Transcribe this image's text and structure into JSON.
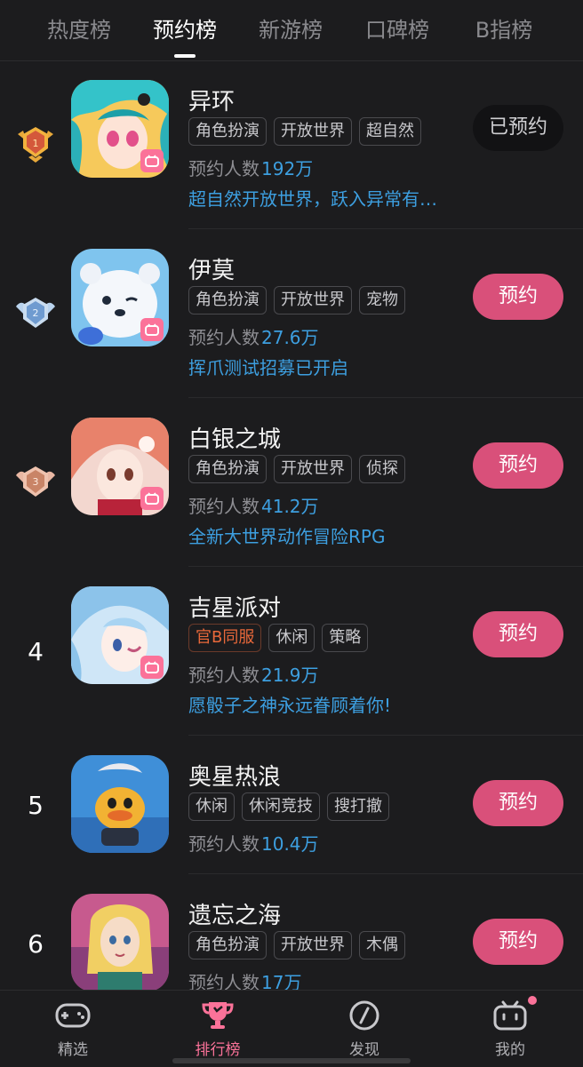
{
  "tabs": [
    {
      "label": "热度榜"
    },
    {
      "label": "预约榜"
    },
    {
      "label": "新游榜"
    },
    {
      "label": "口碑榜"
    },
    {
      "label": "B指榜"
    }
  ],
  "active_tab": "预约榜",
  "stat_label": "预约人数",
  "games": [
    {
      "rank": "1",
      "name": "异环",
      "tags": [
        "角色扮演",
        "开放世界",
        "超自然"
      ],
      "count": "192万",
      "desc": "超自然开放世界，跃入异常有…",
      "button": "已预约"
    },
    {
      "rank": "2",
      "name": "伊莫",
      "tags": [
        "角色扮演",
        "开放世界",
        "宠物"
      ],
      "count": "27.6万",
      "desc": "挥爪测试招募已开启",
      "button": "预约"
    },
    {
      "rank": "3",
      "name": "白银之城",
      "tags": [
        "角色扮演",
        "开放世界",
        "侦探"
      ],
      "count": "41.2万",
      "desc": "全新大世界动作冒险RPG",
      "button": "预约"
    },
    {
      "rank": "4",
      "name": "吉星派对",
      "tags": [
        "官B同服",
        "休闲",
        "策略"
      ],
      "count": "21.9万",
      "desc": "愿骰子之神永远眷顾着你!",
      "button": "预约"
    },
    {
      "rank": "5",
      "name": "奥星热浪",
      "tags": [
        "休闲",
        "休闲竞技",
        "搜打撤"
      ],
      "count": "10.4万",
      "desc": "",
      "button": "预约"
    },
    {
      "rank": "6",
      "name": "遗忘之海",
      "tags": [
        "角色扮演",
        "开放世界",
        "木偶"
      ],
      "count": "17万",
      "desc": "",
      "button": "预约"
    }
  ],
  "bottom_nav": [
    {
      "label": "精选",
      "icon": "gamepad-icon"
    },
    {
      "label": "排行榜",
      "icon": "trophy-icon"
    },
    {
      "label": "发现",
      "icon": "compass-icon"
    },
    {
      "label": "我的",
      "icon": "bilibili-tv-icon"
    }
  ],
  "colors": {
    "accent": "#d9507a",
    "link": "#3d9fe0",
    "background": "#1c1c1e"
  }
}
